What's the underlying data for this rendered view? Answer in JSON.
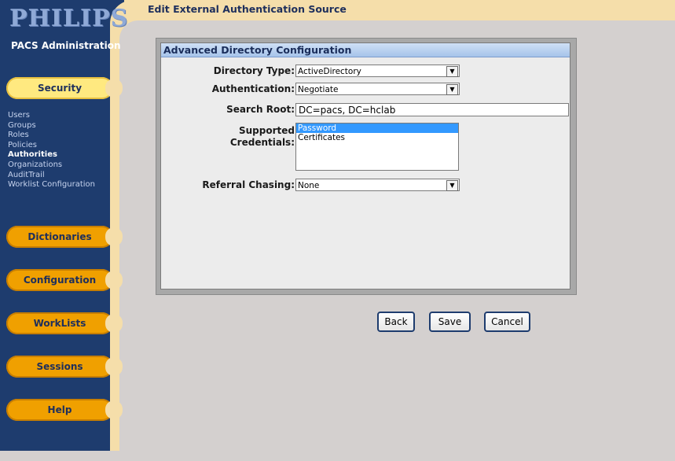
{
  "brand": {
    "logo": "PHILIPS",
    "app_title": "PACS Administration"
  },
  "sidebar": {
    "sections": [
      {
        "label": "Security"
      },
      {
        "label": "Dictionaries"
      },
      {
        "label": "Configuration"
      },
      {
        "label": "WorkLists"
      },
      {
        "label": "Sessions"
      },
      {
        "label": "Help"
      }
    ],
    "security_items": [
      {
        "label": "Users"
      },
      {
        "label": "Groups"
      },
      {
        "label": "Roles"
      },
      {
        "label": "Policies"
      },
      {
        "label": "Authorities"
      },
      {
        "label": "Organizations"
      },
      {
        "label": "AuditTrail"
      },
      {
        "label": "Worklist Configuration"
      }
    ]
  },
  "page": {
    "title": "Edit External Authentication Source"
  },
  "panel": {
    "title": "Advanced Directory Configuration",
    "directory_type": {
      "label": "Directory Type:",
      "value": "ActiveDirectory"
    },
    "authentication": {
      "label": "Authentication:",
      "value": "Negotiate"
    },
    "search_root": {
      "label": "Search Root:",
      "value": "DC=pacs, DC=hclab"
    },
    "credentials": {
      "label_line1": "Supported",
      "label_line2": "Credentials:",
      "options": [
        "Password",
        "Certificates"
      ],
      "selected": "Password"
    },
    "referral_chasing": {
      "label": "Referral Chasing:",
      "value": "None"
    }
  },
  "buttons": {
    "back": "Back",
    "save": "Save",
    "cancel": "Cancel"
  },
  "colors": {
    "sidebar_bg": "#1e3c6e",
    "accent_pill": "#f0a000",
    "active_pill": "#ffe980",
    "header_band": "#f5deaa"
  }
}
